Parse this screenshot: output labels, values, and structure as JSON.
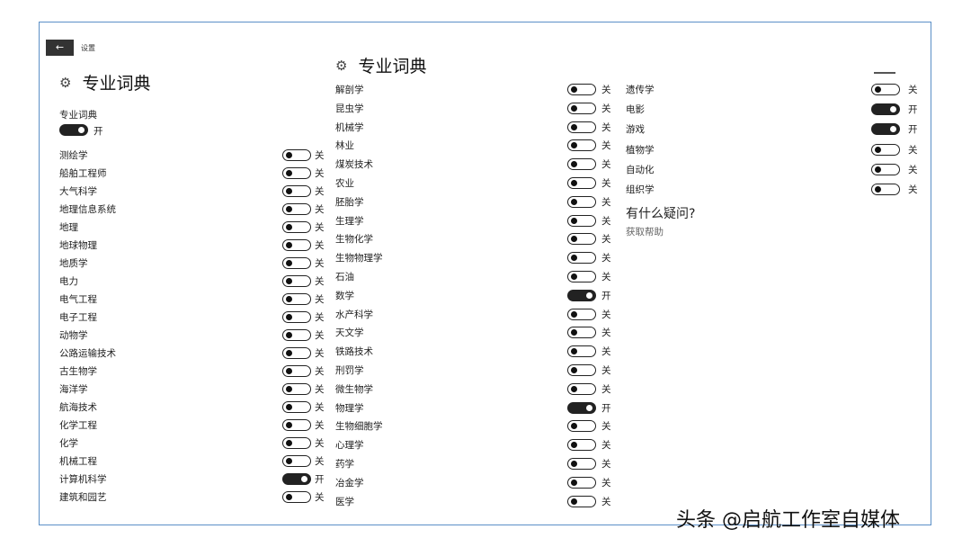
{
  "window": {
    "back_icon": "←",
    "title": "设置"
  },
  "left_panel": {
    "title": "专业词典",
    "gear_icon": "⚙",
    "master_label": "专业词典",
    "master_state": "开",
    "items": [
      {
        "label": "测绘学",
        "on": false,
        "state": "关"
      },
      {
        "label": "船舶工程师",
        "on": false,
        "state": "关"
      },
      {
        "label": "大气科学",
        "on": false,
        "state": "关"
      },
      {
        "label": "地理信息系统",
        "on": false,
        "state": "关"
      },
      {
        "label": "地理",
        "on": false,
        "state": "关"
      },
      {
        "label": "地球物理",
        "on": false,
        "state": "关"
      },
      {
        "label": "地质学",
        "on": false,
        "state": "关"
      },
      {
        "label": "电力",
        "on": false,
        "state": "关"
      },
      {
        "label": "电气工程",
        "on": false,
        "state": "关"
      },
      {
        "label": "电子工程",
        "on": false,
        "state": "关"
      },
      {
        "label": "动物学",
        "on": false,
        "state": "关"
      },
      {
        "label": "公路运输技术",
        "on": false,
        "state": "关"
      },
      {
        "label": "古生物学",
        "on": false,
        "state": "关"
      },
      {
        "label": "海洋学",
        "on": false,
        "state": "关"
      },
      {
        "label": "航海技术",
        "on": false,
        "state": "关"
      },
      {
        "label": "化学工程",
        "on": false,
        "state": "关"
      },
      {
        "label": "化学",
        "on": false,
        "state": "关"
      },
      {
        "label": "机械工程",
        "on": false,
        "state": "关"
      },
      {
        "label": "计算机科学",
        "on": true,
        "state": "开"
      },
      {
        "label": "建筑和园艺",
        "on": false,
        "state": "关"
      }
    ]
  },
  "middle_panel": {
    "title": "专业词典",
    "gear_icon": "⚙",
    "items": [
      {
        "label": "解剖学",
        "on": false,
        "state": "关"
      },
      {
        "label": "昆虫学",
        "on": false,
        "state": "关"
      },
      {
        "label": "机械学",
        "on": false,
        "state": "关"
      },
      {
        "label": "林业",
        "on": false,
        "state": "关"
      },
      {
        "label": "煤炭技术",
        "on": false,
        "state": "关"
      },
      {
        "label": "农业",
        "on": false,
        "state": "关"
      },
      {
        "label": "胚胎学",
        "on": false,
        "state": "关"
      },
      {
        "label": "生理学",
        "on": false,
        "state": "关"
      },
      {
        "label": "生物化学",
        "on": false,
        "state": "关"
      },
      {
        "label": "生物物理学",
        "on": false,
        "state": "关"
      },
      {
        "label": "石油",
        "on": false,
        "state": "关"
      },
      {
        "label": "数学",
        "on": true,
        "state": "开"
      },
      {
        "label": "水产科学",
        "on": false,
        "state": "关"
      },
      {
        "label": "天文学",
        "on": false,
        "state": "关"
      },
      {
        "label": "铁路技术",
        "on": false,
        "state": "关"
      },
      {
        "label": "刑罚学",
        "on": false,
        "state": "关"
      },
      {
        "label": "微生物学",
        "on": false,
        "state": "关"
      },
      {
        "label": "物理学",
        "on": true,
        "state": "开"
      },
      {
        "label": "生物细胞学",
        "on": false,
        "state": "关"
      },
      {
        "label": "心理学",
        "on": false,
        "state": "关"
      },
      {
        "label": "药学",
        "on": false,
        "state": "关"
      },
      {
        "label": "冶金学",
        "on": false,
        "state": "关"
      },
      {
        "label": "医学",
        "on": false,
        "state": "关"
      }
    ]
  },
  "right_panel": {
    "items": [
      {
        "label": "遗传学",
        "on": false,
        "state": "关"
      },
      {
        "label": "电影",
        "on": true,
        "state": "开"
      },
      {
        "label": "游戏",
        "on": true,
        "state": "开"
      },
      {
        "label": "植物学",
        "on": false,
        "state": "关"
      },
      {
        "label": "自动化",
        "on": false,
        "state": "关"
      },
      {
        "label": "组织学",
        "on": false,
        "state": "关"
      }
    ],
    "help_heading": "有什么疑问?",
    "help_link": "获取帮助"
  },
  "watermark": "头条 @启航工作室自媒体"
}
